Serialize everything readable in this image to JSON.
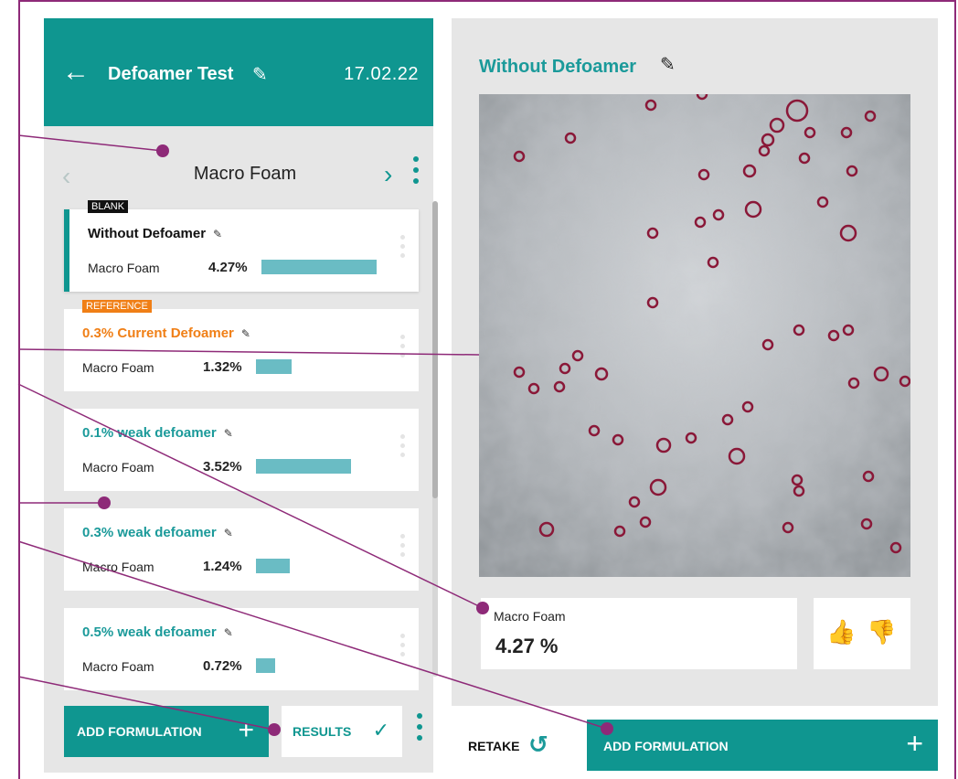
{
  "header": {
    "back_icon": "←",
    "title": "Defoamer Test",
    "edit_icon": "✎",
    "date": "17.02.22"
  },
  "list": {
    "nav_title": "Macro Foam",
    "prev_icon": "‹",
    "next_icon": "›",
    "items": [
      {
        "badge": "BLANK",
        "name": "Without Defoamer",
        "metric": "Macro Foam",
        "percent": "4.27%",
        "value": 4.27
      },
      {
        "badge": "REFERENCE",
        "name": "0.3% Current Defoamer",
        "metric": "Macro Foam",
        "percent": "1.32%",
        "value": 1.32
      },
      {
        "badge": "",
        "name": "0.1% weak defoamer",
        "metric": "Macro Foam",
        "percent": "3.52%",
        "value": 3.52
      },
      {
        "badge": "",
        "name": "0.3% weak defoamer",
        "metric": "Macro Foam",
        "percent": "1.24%",
        "value": 1.24
      },
      {
        "badge": "",
        "name": "0.5% weak defoamer",
        "metric": "Macro Foam",
        "percent": "0.72%",
        "value": 0.72
      }
    ]
  },
  "bottom_left": {
    "add_label": "ADD FORMULATION",
    "add_icon": "+",
    "results_label": "RESULTS",
    "results_icon": "✓"
  },
  "detail": {
    "title": "Without Defoamer",
    "edit_icon": "✎",
    "result_label": "Macro Foam",
    "result_value": "4.27 %",
    "thumbs_up_icon": "👍",
    "thumbs_down_icon": "👎"
  },
  "bottom_right": {
    "retake_label": "RETAKE",
    "retake_icon": "↺",
    "add_label": "ADD FORMULATION",
    "add_icon": "+"
  },
  "colors": {
    "teal": "#0f9690",
    "accent_orange": "#f07f16",
    "annotation": "#8e2a78"
  }
}
